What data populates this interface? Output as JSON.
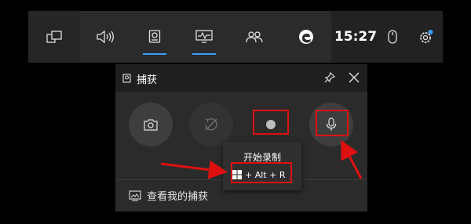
{
  "gamebar": {
    "clock": "15:27",
    "icons": [
      "widget-menu-icon",
      "audio-icon",
      "capture-icon",
      "performance-icon",
      "xbox-social-icon",
      "edge-icon",
      "mouse-icon",
      "settings-icon"
    ],
    "accent_color": "#3b9cff"
  },
  "capture_panel": {
    "title": "捕获",
    "footer_link": "查看我的捕获",
    "buttons": [
      "screenshot-icon",
      "record-last-30s-icon",
      "start-recording-icon",
      "microphone-icon"
    ]
  },
  "tooltip": {
    "title": "开始录制",
    "shortcut": "+ Alt + R"
  },
  "annotation_color": "#e01010"
}
